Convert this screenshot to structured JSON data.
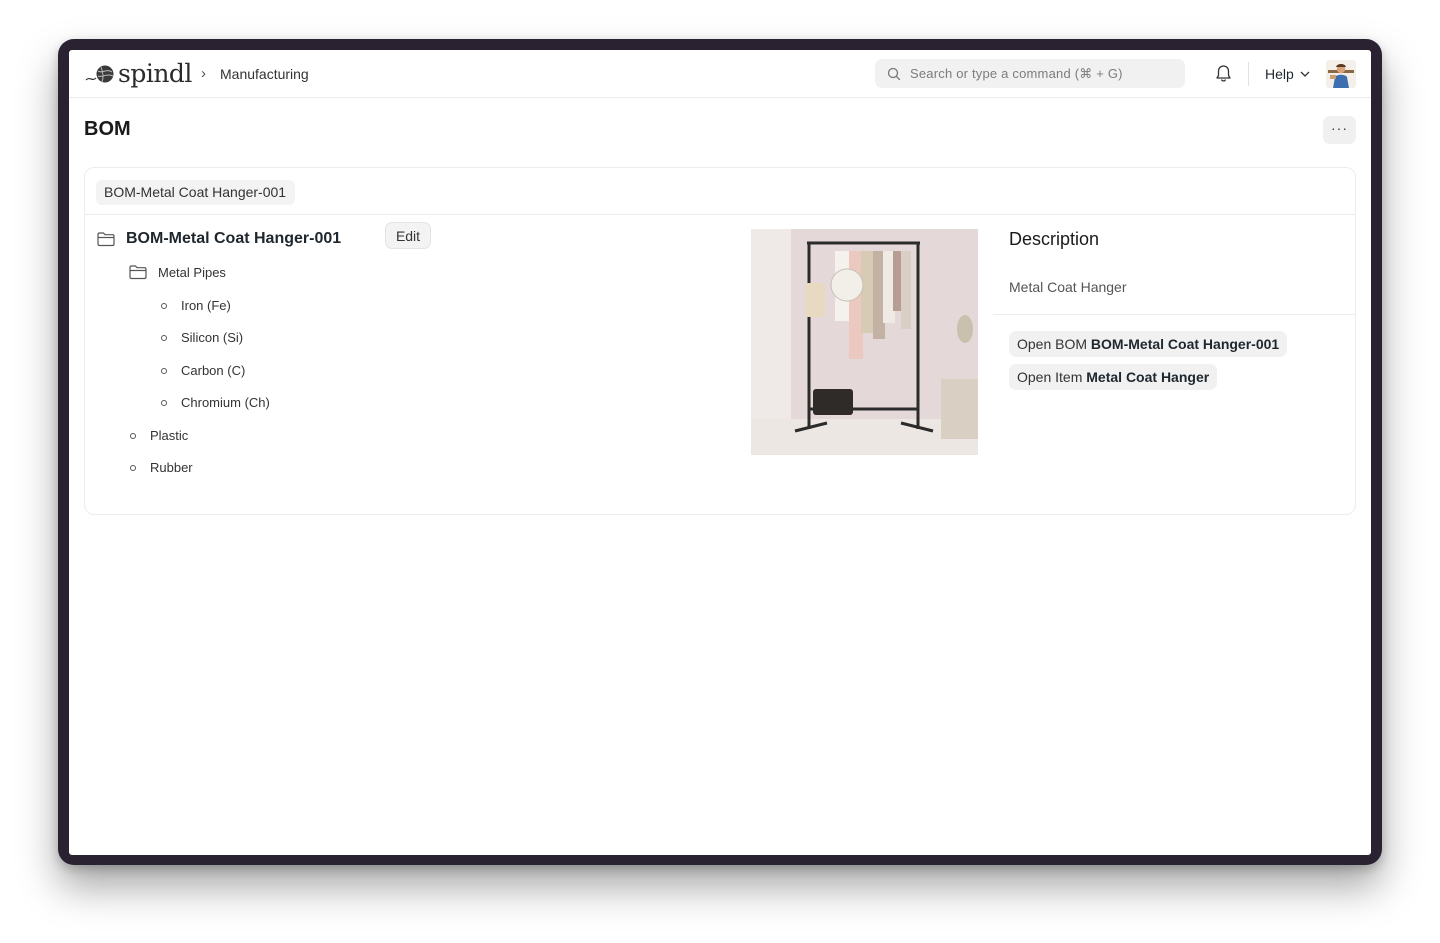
{
  "navbar": {
    "brand": "spindl",
    "breadcrumb_separator": "›",
    "breadcrumb": "Manufacturing",
    "search_placeholder": "Search or type a command (⌘ + G)",
    "help_label": "Help"
  },
  "page": {
    "title": "BOM",
    "more_label": "···"
  },
  "bom_selector": "BOM-Metal Coat Hanger-001",
  "tree": {
    "root_label": "BOM-Metal Coat Hanger-001",
    "edit_label": "Edit",
    "nodes": [
      {
        "label": "Metal Pipes",
        "kind": "folder",
        "level": 1
      },
      {
        "label": "Iron (Fe)",
        "kind": "leaf",
        "level": 2
      },
      {
        "label": "Silicon (Si)",
        "kind": "leaf",
        "level": 2
      },
      {
        "label": "Carbon (C)",
        "kind": "leaf",
        "level": 2
      },
      {
        "label": "Chromium (Ch)",
        "kind": "leaf",
        "level": 2
      },
      {
        "label": "Plastic",
        "kind": "leaf",
        "level": 1
      },
      {
        "label": "Rubber",
        "kind": "leaf",
        "level": 1
      }
    ]
  },
  "details": {
    "title": "Description",
    "description": "Metal Coat Hanger",
    "links": [
      {
        "prefix": "Open BOM",
        "name": "BOM-Metal Coat Hanger-001"
      },
      {
        "prefix": "Open Item",
        "name": "Metal Coat Hanger"
      }
    ]
  },
  "colors": {
    "screen_bg": "#ffffff",
    "device_frame": "#2a2230",
    "chip_bg": "#f3f3f3",
    "text_primary": "#1f272e"
  }
}
